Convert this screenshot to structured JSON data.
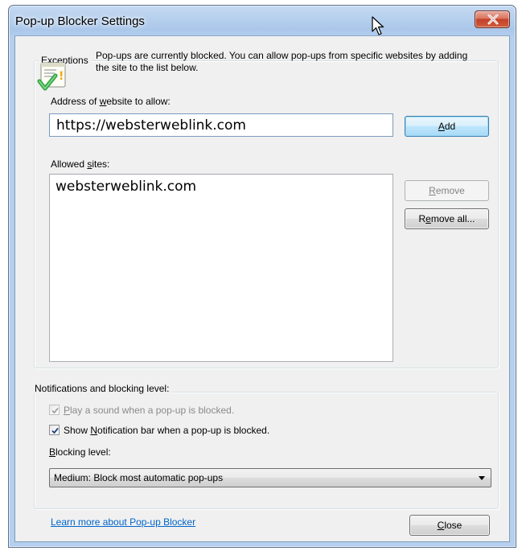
{
  "window": {
    "title": "Pop-up Blocker Settings"
  },
  "exceptions": {
    "group_label": "Exceptions",
    "info_text": "Pop-ups are currently blocked.  You can allow pop-ups from specific websites by adding the site to the list below.",
    "address_label_pre": "Address of ",
    "address_label_ul": "w",
    "address_label_post": "ebsite to allow:",
    "address_value": "https://websterweblink.com",
    "add_button": {
      "pre": "",
      "ul": "A",
      "post": "dd"
    },
    "allowed_label_pre": "Allowed ",
    "allowed_label_ul": "s",
    "allowed_label_post": "ites:",
    "allowed_sites": [
      "websterweblink.com"
    ],
    "remove_button": {
      "pre": "",
      "ul": "R",
      "post": "emove"
    },
    "remove_all_button": {
      "pre": "R",
      "ul": "e",
      "post": "move all..."
    }
  },
  "notifications": {
    "group_label": "Notifications and blocking level:",
    "play_sound": {
      "pre": "",
      "ul": "P",
      "post": "lay a sound when a pop-up is blocked.",
      "checked": true,
      "disabled": true
    },
    "show_bar": {
      "pre": "Show ",
      "ul": "N",
      "post": "otification bar when a pop-up is blocked.",
      "checked": true,
      "disabled": false
    },
    "blocking_label_pre": "",
    "blocking_label_ul": "B",
    "blocking_label_post": "locking level:",
    "blocking_selected": "Medium: Block most automatic pop-ups"
  },
  "footer": {
    "learn_more": "Learn more about Pop-up Blocker",
    "close_button": {
      "pre": "",
      "ul": "C",
      "post": "lose"
    }
  },
  "icons": {
    "close": "close-icon",
    "info": "warning-check-icon",
    "checkmark": "checkmark-icon",
    "dropdown": "chevron-down-icon",
    "cursor": "mouse-pointer-icon"
  },
  "colors": {
    "link": "#0066cc",
    "close_button_red": "#c3402a",
    "default_button_blue": "#3c7fb1"
  }
}
